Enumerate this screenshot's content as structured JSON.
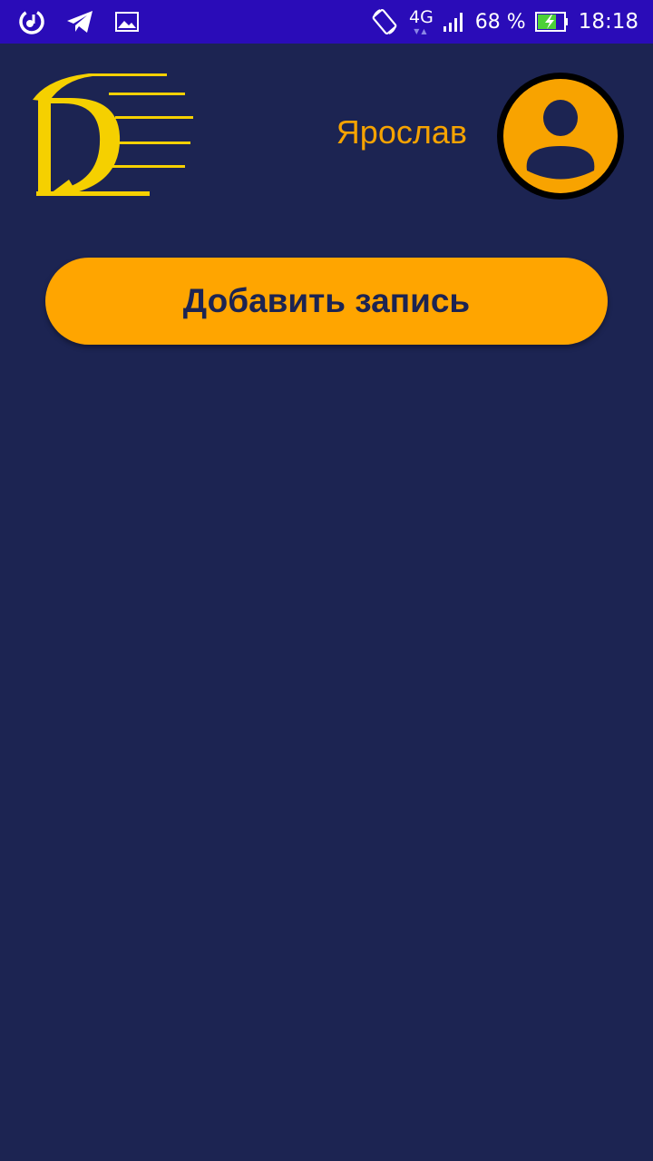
{
  "status_bar": {
    "network": "4G",
    "battery_percent": "68 %",
    "time": "18:18",
    "icons": [
      "music-app-icon",
      "telegram-icon",
      "gallery-icon",
      "rotate-icon",
      "signal-icon",
      "battery-charging-icon"
    ]
  },
  "header": {
    "user_name": "Ярослав"
  },
  "main": {
    "add_button_label": "Добавить запись"
  },
  "colors": {
    "background": "#1c2452",
    "status_bar": "#2a0cb8",
    "accent": "#ffa500",
    "logo": "#f5d000"
  }
}
